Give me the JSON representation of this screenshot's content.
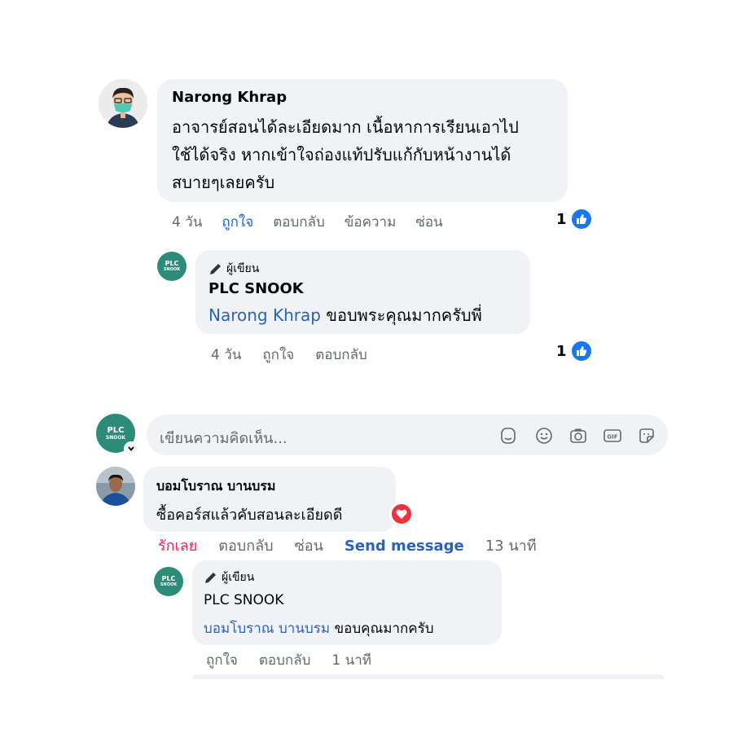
{
  "comment1": {
    "author": "Narong Khrap",
    "text_lines": [
      "อาจารย์สอนได้ละเอียดมาก เนื้อหาการเรียนเอาไป",
      "ใช้ได้จริง หากเข้าใจถ่องแท้ปรับแก้กับหน้างานได้",
      "สบายๆเลยครับ"
    ],
    "time": "4 วัน",
    "like": "ถูกใจ",
    "reply": "ตอบกลับ",
    "message": "ข้อความ",
    "hide": "ซ่อน",
    "reaction_count": "1"
  },
  "reply1": {
    "badge": "ผู้เขียน",
    "author": "PLC SNOOK",
    "mention": "Narong Khrap",
    "text": " ขอบพระคุณมากครับพี่",
    "time": "4 วัน",
    "like": "ถูกใจ",
    "reply": "ตอบกลับ",
    "reaction_count": "1"
  },
  "composer": {
    "placeholder": "เขียนความคิดเห็น..."
  },
  "avatars": {
    "plc_line1": "PLC",
    "plc_line2": "SNOOK"
  },
  "comment2": {
    "author": "บอมโบราณ บานบรม",
    "text": "ซื้อคอร์สแล้วคับสอนละเอียดดี",
    "love": "รักเลย",
    "reply": "ตอบกลับ",
    "hide": "ซ่อน",
    "send_message": "Send message",
    "time": "13 นาที"
  },
  "reply2": {
    "badge": "ผู้เขียน",
    "author": "PLC SNOOK",
    "mention": "บอมโบราณ บานบรม",
    "text": " ขอบคุณมากครับ",
    "like": "ถูกใจ",
    "reply": "ตอบกลับ",
    "time": "1 นาที"
  },
  "colors": {
    "bubble": "#f0f2f5",
    "link": "#2d63b6",
    "like_blue": "#1877f2",
    "love_red": "#e0245e",
    "plc_green": "#2e8b7a"
  }
}
